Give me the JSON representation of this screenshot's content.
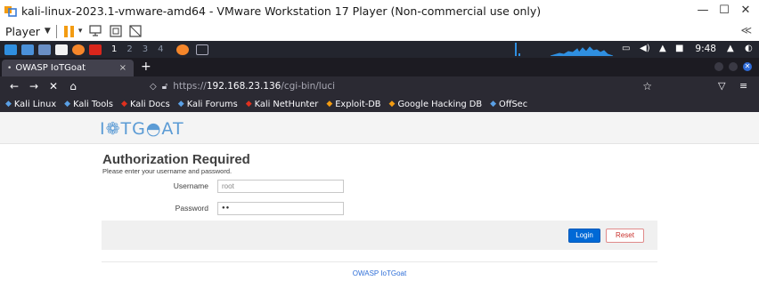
{
  "window": {
    "title": "kali-linux-2023.1-vmware-amd64 - VMware Workstation 17 Player (Non-commercial use only)",
    "minimize": "—",
    "maximize": "☐",
    "close": "✕"
  },
  "vm_toolbar": {
    "player_label": "Player",
    "caret": "▼",
    "more": "≪"
  },
  "kali_panel": {
    "workspaces": [
      "1",
      "2",
      "3",
      "4"
    ],
    "clock": "9:48"
  },
  "browser": {
    "tab_label": "OWASP IoTGoat",
    "tab_close": "×",
    "new_tab": "+",
    "url_prefix": "https://",
    "url_host": "192.168.23.136",
    "url_path": "/cgi-bin/luci"
  },
  "bookmarks": [
    {
      "label": "Kali Linux",
      "icon": "kali-icon",
      "color": "#5aa0e6"
    },
    {
      "label": "Kali Tools",
      "icon": "kali-tools-icon",
      "color": "#5aa0e6"
    },
    {
      "label": "Kali Docs",
      "icon": "kali-docs-icon",
      "color": "#e0301e"
    },
    {
      "label": "Kali Forums",
      "icon": "kali-forums-icon",
      "color": "#5aa0e6"
    },
    {
      "label": "Kali NetHunter",
      "icon": "nethunter-icon",
      "color": "#e0301e"
    },
    {
      "label": "Exploit-DB",
      "icon": "exploit-db-icon",
      "color": "#f39c12"
    },
    {
      "label": "Google Hacking DB",
      "icon": "ghdb-icon",
      "color": "#f39c12"
    },
    {
      "label": "OffSec",
      "icon": "offsec-icon",
      "color": "#5aa0e6"
    }
  ],
  "page": {
    "brand": "I❁TG◓AT",
    "heading": "Authorization Required",
    "subtext": "Please enter your username and password.",
    "username_label": "Username",
    "username_value": "root",
    "password_label": "Password",
    "password_value": "●●",
    "login_label": "Login",
    "reset_label": "Reset",
    "footer_link": "OWASP IoTGoat"
  },
  "colors": {
    "accent": "#0069d6",
    "reset": "#c9302c",
    "kali_panel": "#23252e",
    "browser_chrome": "#2b2a33"
  }
}
